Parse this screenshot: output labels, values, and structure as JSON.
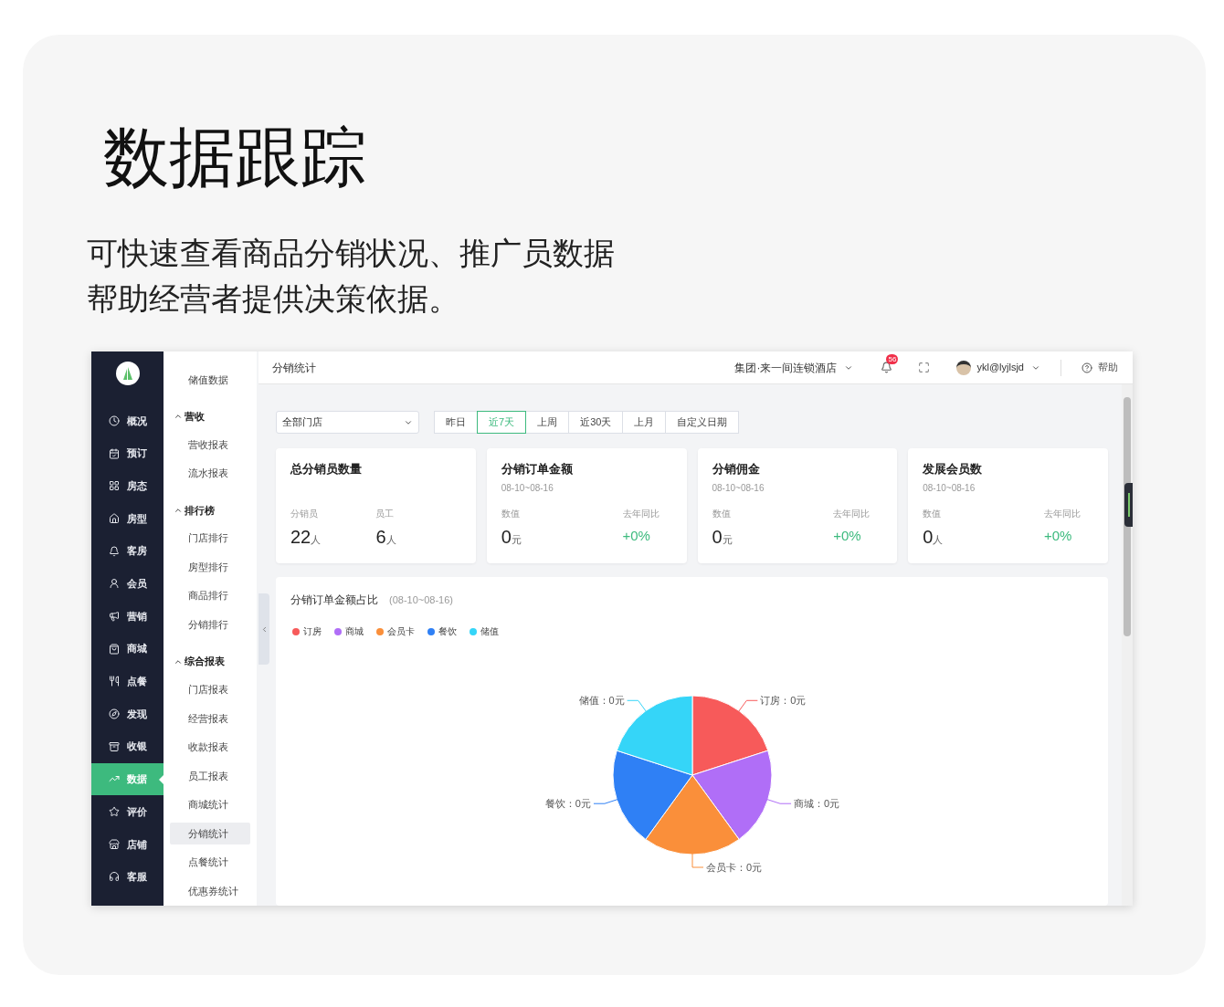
{
  "heading": {
    "title": "数据跟踪",
    "lines": [
      "可快速查看商品分销状况、推广员数据",
      "帮助经营者提供决策依据。"
    ]
  },
  "app": {
    "nav": [
      {
        "label": "概况",
        "selected": false
      },
      {
        "label": "预订",
        "selected": false
      },
      {
        "label": "房态",
        "selected": false
      },
      {
        "label": "房型",
        "selected": false
      },
      {
        "label": "客房",
        "selected": false
      },
      {
        "label": "会员",
        "selected": false
      },
      {
        "label": "营销",
        "selected": false
      },
      {
        "label": "商城",
        "selected": false
      },
      {
        "label": "点餐",
        "selected": false
      },
      {
        "label": "发现",
        "selected": false
      },
      {
        "label": "收银",
        "selected": false
      },
      {
        "label": "数据",
        "selected": true
      },
      {
        "label": "评价",
        "selected": false
      },
      {
        "label": "店铺",
        "selected": false
      },
      {
        "label": "客服",
        "selected": false
      }
    ],
    "submenu": [
      {
        "kind": "item",
        "label": "储值数据",
        "selected": false
      },
      {
        "kind": "group",
        "label": "营收",
        "expanded": true
      },
      {
        "kind": "item",
        "label": "营收报表",
        "selected": false
      },
      {
        "kind": "item",
        "label": "流水报表",
        "selected": false
      },
      {
        "kind": "group",
        "label": "排行榜",
        "expanded": true
      },
      {
        "kind": "item",
        "label": "门店排行",
        "selected": false
      },
      {
        "kind": "item",
        "label": "房型排行",
        "selected": false
      },
      {
        "kind": "item",
        "label": "商品排行",
        "selected": false
      },
      {
        "kind": "item",
        "label": "分销排行",
        "selected": false
      },
      {
        "kind": "group",
        "label": "综合报表",
        "expanded": true
      },
      {
        "kind": "item",
        "label": "门店报表",
        "selected": false
      },
      {
        "kind": "item",
        "label": "经营报表",
        "selected": false
      },
      {
        "kind": "item",
        "label": "收款报表",
        "selected": false
      },
      {
        "kind": "item",
        "label": "员工报表",
        "selected": false
      },
      {
        "kind": "item",
        "label": "商城统计",
        "selected": false
      },
      {
        "kind": "item",
        "label": "分销统计",
        "selected": true
      },
      {
        "kind": "item",
        "label": "点餐统计",
        "selected": false
      },
      {
        "kind": "item",
        "label": "优惠券统计",
        "selected": false
      }
    ],
    "page_title": "分销统计",
    "topbar": {
      "org": "集团·来一间连锁酒店",
      "notifications": "56",
      "user": "ykl@lyjlsjd",
      "help": "帮助"
    },
    "store_select": "全部门店",
    "ranges": [
      {
        "label": "昨日",
        "selected": false
      },
      {
        "label": "近7天",
        "selected": true
      },
      {
        "label": "上周",
        "selected": false
      },
      {
        "label": "近30天",
        "selected": false
      },
      {
        "label": "上月",
        "selected": false
      },
      {
        "label": "自定义日期",
        "selected": false
      }
    ],
    "cards": [
      {
        "title": "总分销员数量",
        "stats": [
          {
            "kind": "number",
            "label": "分销员",
            "value": "22",
            "unit": "人"
          },
          {
            "kind": "number",
            "label": "员工",
            "value": "6",
            "unit": "人"
          }
        ]
      },
      {
        "title": "分销订单金额",
        "date": "08-10~08-16",
        "stats": [
          {
            "kind": "number",
            "label": "数值",
            "value": "0",
            "unit": "元"
          },
          {
            "kind": "change",
            "label": "去年同比",
            "value": "+0%"
          }
        ]
      },
      {
        "title": "分销佣金",
        "date": "08-10~08-16",
        "stats": [
          {
            "kind": "number",
            "label": "数值",
            "value": "0",
            "unit": "元"
          },
          {
            "kind": "change",
            "label": "去年同比",
            "value": "+0%"
          }
        ]
      },
      {
        "title": "发展会员数",
        "date": "08-10~08-16",
        "stats": [
          {
            "kind": "number",
            "label": "数值",
            "value": "0",
            "unit": "人"
          },
          {
            "kind": "change",
            "label": "去年同比",
            "value": "+0%"
          }
        ]
      }
    ],
    "chart": {
      "title": "分销订单金额占比",
      "range": "(08-10~08-16)",
      "legend": [
        {
          "label": "订房",
          "color": "#f75a5a"
        },
        {
          "label": "商城",
          "color": "#b06ef7"
        },
        {
          "label": "会员卡",
          "color": "#fa8f3a"
        },
        {
          "label": "餐饮",
          "color": "#2f80f5"
        },
        {
          "label": "储值",
          "color": "#35d5f8"
        }
      ],
      "slice_labels": [
        "订房：0元",
        "商城：0元",
        "会员卡：0元",
        "餐饮：0元",
        "储值：0元"
      ]
    }
  }
}
